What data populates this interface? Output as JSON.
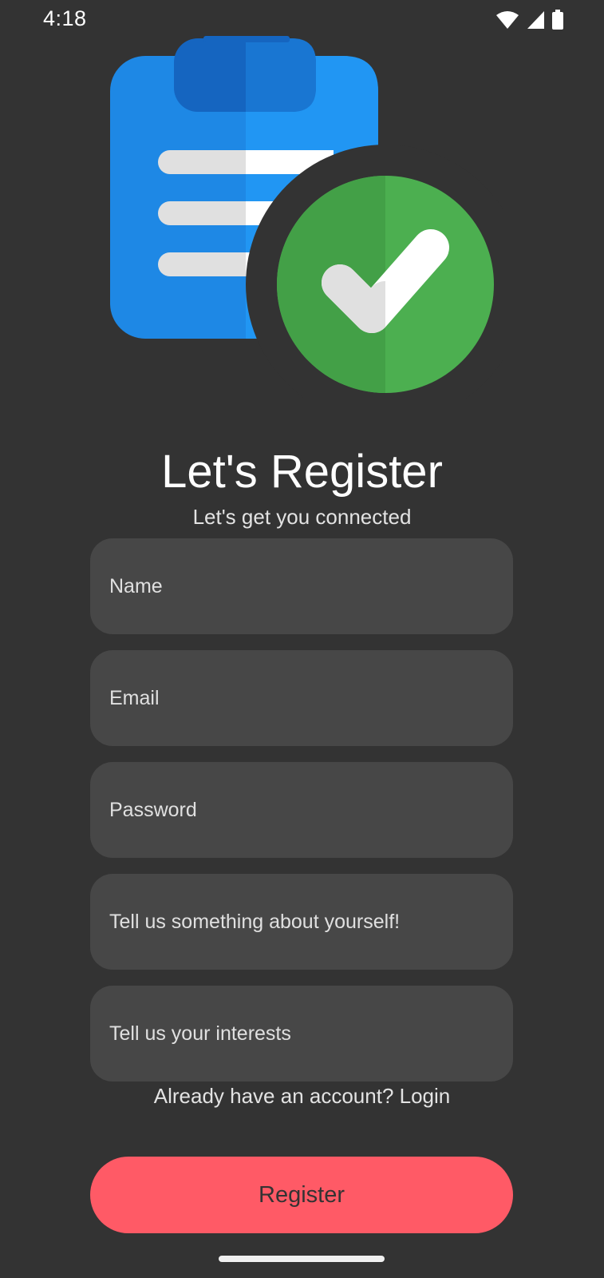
{
  "status_bar": {
    "time": "4:18",
    "icons": [
      "wifi-icon",
      "signal-icon",
      "battery-icon"
    ]
  },
  "hero": {
    "icon": "clipboard-check-icon",
    "colors": {
      "clipboard_light": "#2196F3",
      "clipboard_dark": "#1E88E5",
      "clip_light": "#1976D2",
      "clip_dark": "#1565C0",
      "lines": "#E0E0E0",
      "check_circle_light": "#4CAF50",
      "check_circle_dark": "#43A047"
    }
  },
  "header": {
    "title": "Let's Register",
    "subtitle": "Let's get you connected"
  },
  "form": {
    "name_placeholder": "Name",
    "email_placeholder": "Email",
    "password_placeholder": "Password",
    "about_placeholder": "Tell us something about yourself!",
    "interests_placeholder": "Tell us your interests"
  },
  "login_link": "Already have an account? Login",
  "register_label": "Register",
  "colors": {
    "background": "#333333",
    "field_background": "#474747",
    "accent": "#FF5A66"
  }
}
